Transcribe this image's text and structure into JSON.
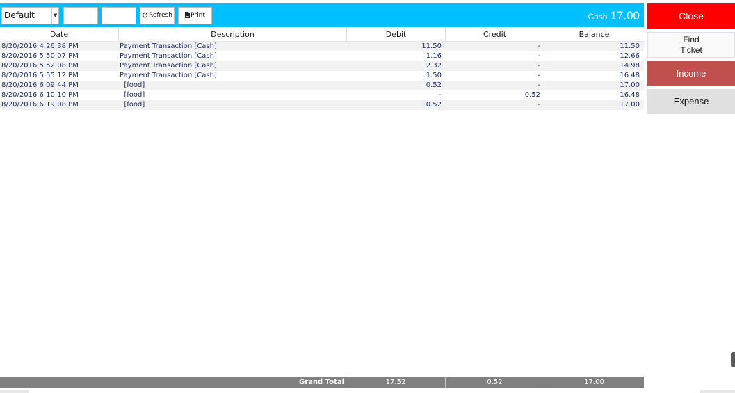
{
  "toolbar": {
    "select_value": "Default",
    "refresh_label": "Refresh",
    "print_label": "Print",
    "cash_label": "Cash",
    "cash_amount": "17.00",
    "background_color": "#00bfff"
  },
  "side_panel": {
    "close_label": "Close",
    "find_ticket_label": "Find\nTicket",
    "income_label": "Income",
    "expense_label": "Expense",
    "close_color": "#ff0000",
    "income_color": "#c0504d"
  },
  "table": {
    "columns": [
      "Date",
      "Description",
      "Debit",
      "Credit",
      "Balance"
    ],
    "rows": [
      {
        "date": "8/20/2016 4:26:38 PM",
        "description": "Payment Transaction [Cash]",
        "debit": "11.50",
        "credit": "-",
        "balance": "11.50"
      },
      {
        "date": "8/20/2016 5:50:07 PM",
        "description": "Payment Transaction [Cash]",
        "debit": "1.16",
        "credit": "-",
        "balance": "12.66"
      },
      {
        "date": "8/20/2016 5:52:08 PM",
        "description": "Payment Transaction [Cash]",
        "debit": "2.32",
        "credit": "-",
        "balance": "14.98"
      },
      {
        "date": "8/20/2016 5:55:12 PM",
        "description": "Payment Transaction [Cash]",
        "debit": "1.50",
        "credit": "-",
        "balance": "16.48"
      },
      {
        "date": "8/20/2016 6:09:44 PM",
        "description": "  [food]",
        "debit": "0.52",
        "credit": "-",
        "balance": "17.00"
      },
      {
        "date": "8/20/2016 6:10:10 PM",
        "description": "  [food]",
        "debit": "-",
        "credit": "0.52",
        "balance": "16.48"
      },
      {
        "date": "8/20/2016 6:19:08 PM",
        "description": "  [food]",
        "debit": "0.52",
        "credit": "-",
        "balance": "17.00"
      }
    ]
  },
  "footer": {
    "label": "Grand Total",
    "debit_total": "17.52",
    "credit_total": "0.52",
    "balance_total": "17.00"
  }
}
